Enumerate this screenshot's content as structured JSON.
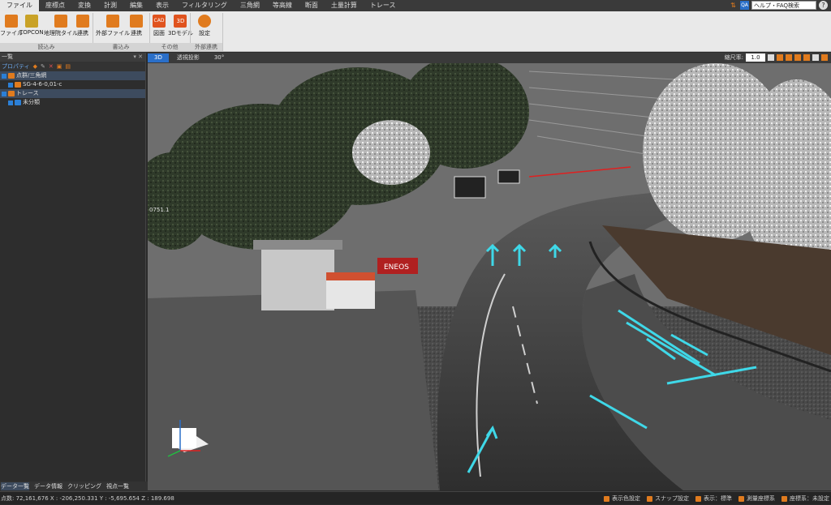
{
  "menu": {
    "items": [
      "ファイル",
      "座標点",
      "変換",
      "計測",
      "編集",
      "表示",
      "フィルタリング",
      "三角網",
      "等高線",
      "断面",
      "土量計算",
      "トレース"
    ],
    "active_index": 0
  },
  "help": {
    "search_value": "ヘルプ・FAQ検索",
    "question": "?"
  },
  "ribbon": {
    "buttons": [
      {
        "label": "ファイル",
        "color": "#e07b1e"
      },
      {
        "label": "TOPCON",
        "color": "#c9a227"
      },
      {
        "label": "地理院タイル",
        "color": "#e07b1e"
      },
      {
        "label": "連携",
        "color": "#e07b1e"
      },
      {
        "label": "外部ファイル",
        "color": "#e07b1e"
      },
      {
        "label": "連携",
        "color": "#e07b1e"
      },
      {
        "label": "図面",
        "color": "#e0531e"
      },
      {
        "label": "3Dモデル",
        "color": "#e0531e"
      },
      {
        "label": "設定",
        "color": "#e07b1e"
      }
    ],
    "button_icon_text": {
      "cad": "CAD",
      "model3d": "3D"
    },
    "groups": [
      "読込み",
      "書込み",
      "その他",
      "外部連携"
    ]
  },
  "left_panel": {
    "title": "一覧",
    "toolbar_label": "プロパティ",
    "tree": [
      {
        "label": "点群/三角網",
        "level": 0
      },
      {
        "label": "SG-4-6-0,01-c",
        "level": 1
      },
      {
        "label": "トレース",
        "level": 0
      },
      {
        "label": "未分類",
        "level": 1
      }
    ],
    "bottom_tabs": [
      "データ一覧",
      "データ情報",
      "クリッピング",
      "視点一覧"
    ]
  },
  "viewport": {
    "tabs": [
      "3D",
      "透視投影",
      "30°"
    ],
    "active_tab": 0,
    "scale_label": "縮尺率:",
    "scale_value": "1.0",
    "overlay_text": "0751.1",
    "sign_text": "ENEOS",
    "colors": {
      "annotation": "#3fd8e8",
      "border_line": "#e02020",
      "axis_z": "#2a6fc9",
      "axis_x": "#e02020",
      "axis_y": "#20c040"
    }
  },
  "status": {
    "left": "点数: 72,161,676    X : -206,250.331  Y : -5,695.654  Z : 189.698",
    "right": [
      "表示色設定",
      "スナップ設定",
      "表示：標準",
      "測量座標系",
      "座標系：未設定"
    ]
  }
}
